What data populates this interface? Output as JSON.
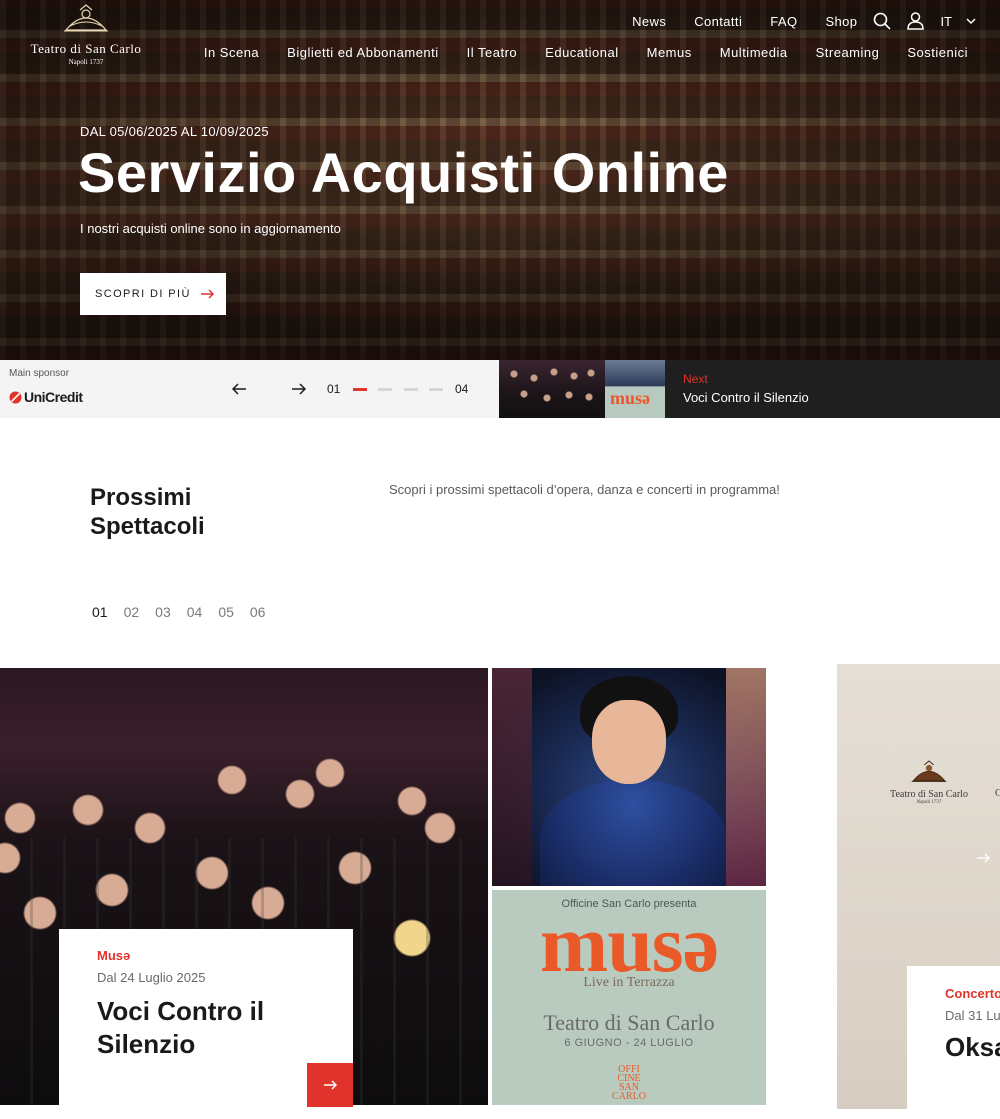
{
  "brand": {
    "name": "Teatro di San Carlo",
    "subtitle": "Napoli 1737"
  },
  "top_nav": {
    "links": [
      "News",
      "Contatti",
      "FAQ",
      "Shop"
    ],
    "language": "IT",
    "icons": [
      "search-icon",
      "user-icon",
      "chevron-down-icon"
    ]
  },
  "main_nav": {
    "items": [
      "In Scena",
      "Biglietti ed Abbonamenti",
      "Il Teatro",
      "Educational",
      "Memus",
      "Multimedia",
      "Streaming",
      "Sostienici"
    ]
  },
  "hero": {
    "date_range": "DAL 05/06/2025 AL 10/09/2025",
    "title": "Servizio Acquisti Online",
    "subtitle": "I nostri acquisti online sono in aggiornamento",
    "cta_label": "SCOPRI DI PIÙ"
  },
  "slider": {
    "sponsor_label": "Main sponsor",
    "sponsor_name": "UniCredit",
    "current_page": "01",
    "total_pages": "04",
    "active_index": 1,
    "next_label": "Next",
    "next_title": "Voci Contro il Silenzio",
    "next_poster_text": "musə"
  },
  "upcoming": {
    "title": "Prossimi Spettacoli",
    "description": "Scopri i prossimi spettacoli d’opera, danza e concerti in programma!",
    "tabs": [
      "01",
      "02",
      "03",
      "04",
      "05",
      "06"
    ],
    "active_tab": "01"
  },
  "cards": [
    {
      "category": "Musə",
      "date": "Dal 24 Luglio 2025",
      "title": "Voci Contro il Silenzio"
    },
    {
      "category": "Concerto",
      "date": "Dal 31 Lu",
      "title": "Oksa",
      "poster_logo_title": "Teatro di San Carlo",
      "poster_logo_sub": "Napoli 1737",
      "poster_extra": "C"
    }
  ],
  "poster": {
    "presenter": "Officine San Carlo presenta",
    "title": "musə",
    "subtitle": "Live in Terrazza",
    "venue": "Teatro di San Carlo",
    "dates": "6 GIUGNO - 24 LUGLIO",
    "logo": "OFFI CINE SAN CARLO"
  },
  "colors": {
    "accent": "#e0332b",
    "dark_panel": "#1f1f1f",
    "poster_orange": "#ea5a28",
    "poster_bg": "#b9cbbf"
  }
}
